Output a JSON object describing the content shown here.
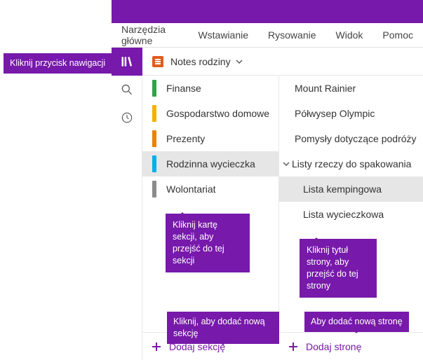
{
  "callouts": {
    "nav": "Kliknij przycisk nawigacji",
    "section": "Kliknij kartę sekcji, aby przejść do tej sekcji",
    "page": "Kliknij tytuł strony, aby przejść do tej strony",
    "add_section": "Kliknij, aby dodać nową sekcję",
    "add_page": "Aby dodać nową stronę"
  },
  "ribbon": {
    "tabs": [
      "Narzędzia główne",
      "Wstawianie",
      "Rysowanie",
      "Widok",
      "Pomoc"
    ]
  },
  "notebook": {
    "title": "Notes rodziny"
  },
  "sections": [
    {
      "label": "Finanse",
      "color": "#2ea34a"
    },
    {
      "label": "Gospodarstwo domowe",
      "color": "#f0b400"
    },
    {
      "label": "Prezenty",
      "color": "#e88300"
    },
    {
      "label": "Rodzinna wycieczka",
      "color": "#00b0e6",
      "selected": true
    },
    {
      "label": "Wolontariat",
      "color": "#8c8c8c"
    }
  ],
  "pages": [
    {
      "label": "Mount Rainier"
    },
    {
      "label": "Półwysep Olympic"
    },
    {
      "label": "Pomysły dotyczące podróży"
    },
    {
      "label": "Listy rzeczy do spakowania",
      "parent": true
    },
    {
      "label": "Lista kempingowa",
      "child": true,
      "selected": true
    },
    {
      "label": "Lista wycieczkowa",
      "child": true
    }
  ],
  "add": {
    "section": "Dodaj sekcję",
    "page": "Dodaj stronę"
  }
}
